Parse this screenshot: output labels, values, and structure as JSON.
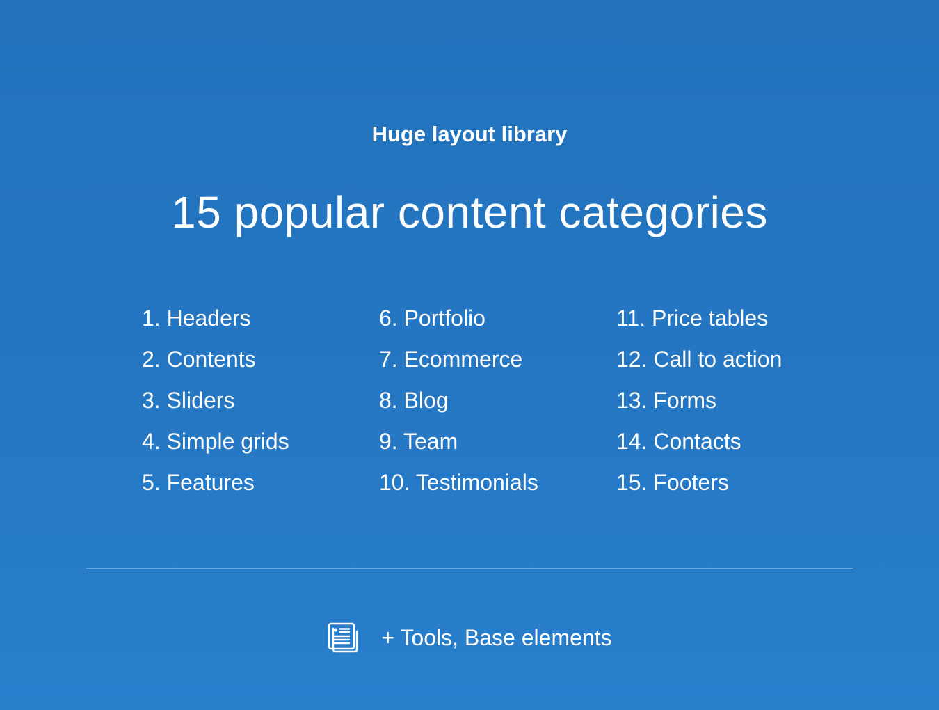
{
  "hero": {
    "eyebrow": "Huge layout library",
    "headline": "15 popular content categories"
  },
  "categories": {
    "column_1": [
      "1. Headers",
      "2. Contents",
      "3. Sliders",
      "4. Simple grids",
      "5. Features"
    ],
    "column_2": [
      "6. Portfolio",
      "7. Ecommerce",
      "8. Blog",
      "9. Team",
      "10. Testimonials"
    ],
    "column_3": [
      "11. Price tables",
      "12. Call to action",
      "13. Forms",
      "14. Contacts",
      "15. Footers"
    ]
  },
  "footer": {
    "icon": "document-stack-icon",
    "text": "+ Tools, Base elements"
  },
  "colors": {
    "background_top": "#2272bc",
    "background_bottom": "#287fcc",
    "text": "#ffffff"
  }
}
